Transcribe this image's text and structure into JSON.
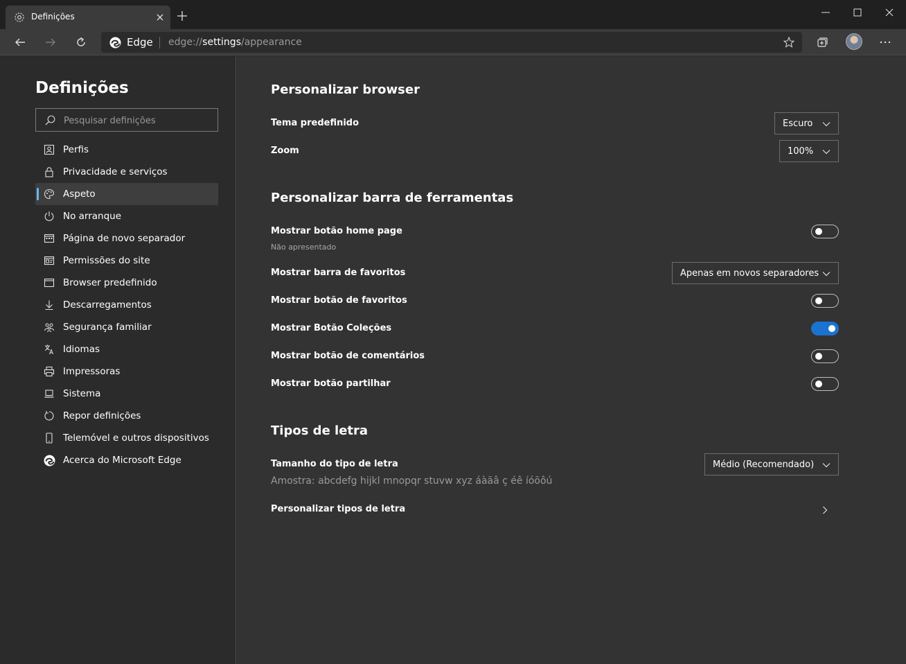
{
  "tab": {
    "title": "Definições",
    "close_label": "×"
  },
  "toolbar": {
    "brand": "Edge",
    "url_scheme": "edge://",
    "url_host": "settings",
    "url_path": "/appearance"
  },
  "sidebar": {
    "title": "Definições",
    "search_placeholder": "Pesquisar definições",
    "items": [
      {
        "label": "Perfis",
        "icon": "profile-icon"
      },
      {
        "label": "Privacidade e serviços",
        "icon": "lock-icon"
      },
      {
        "label": "Aspeto",
        "icon": "palette-icon",
        "active": true
      },
      {
        "label": "No arranque",
        "icon": "power-icon"
      },
      {
        "label": "Página de novo separador",
        "icon": "new-tab-page-icon"
      },
      {
        "label": "Permissões do site",
        "icon": "site-permissions-icon"
      },
      {
        "label": "Browser predefinido",
        "icon": "default-browser-icon"
      },
      {
        "label": "Descarregamentos",
        "icon": "download-icon"
      },
      {
        "label": "Segurança familiar",
        "icon": "family-icon"
      },
      {
        "label": "Idiomas",
        "icon": "language-icon"
      },
      {
        "label": "Impressoras",
        "icon": "printer-icon"
      },
      {
        "label": "Sistema",
        "icon": "laptop-icon"
      },
      {
        "label": "Repor definições",
        "icon": "reset-icon"
      },
      {
        "label": "Telemóvel e outros dispositivos",
        "icon": "phone-icon"
      },
      {
        "label": "Acerca do Microsoft Edge",
        "icon": "edge-logo-icon"
      }
    ]
  },
  "main": {
    "section_browser": {
      "title": "Personalizar browser",
      "theme_label": "Tema predefinido",
      "theme_value": "Escuro",
      "zoom_label": "Zoom",
      "zoom_value": "100%"
    },
    "section_toolbar": {
      "title": "Personalizar barra de ferramentas",
      "home_label": "Mostrar botão home page",
      "home_sub": "Não apresentado",
      "home_on": false,
      "favbar_label": "Mostrar barra de favoritos",
      "favbar_value": "Apenas em novos separadores",
      "favbtn_label": "Mostrar botão de favoritos",
      "favbtn_on": false,
      "collections_label": "Mostrar Botão Coleções",
      "collections_on": true,
      "feedback_label": "Mostrar botão de comentários",
      "feedback_on": false,
      "share_label": "Mostrar botão partilhar",
      "share_on": false
    },
    "section_fonts": {
      "title": "Tipos de letra",
      "size_label": "Tamanho do tipo de letra",
      "size_value": "Médio (Recomendado)",
      "sample": "Amostra: abcdefg hijkl mnopqr stuvw xyz áàãâ ç éê íóõôú",
      "customize_label": "Personalizar tipos de letra"
    }
  },
  "colors": {
    "accent": "#1a73d0",
    "active_indicator": "#6db6f0",
    "sidebar_bg": "#2b2b2b",
    "main_bg": "#333333"
  }
}
